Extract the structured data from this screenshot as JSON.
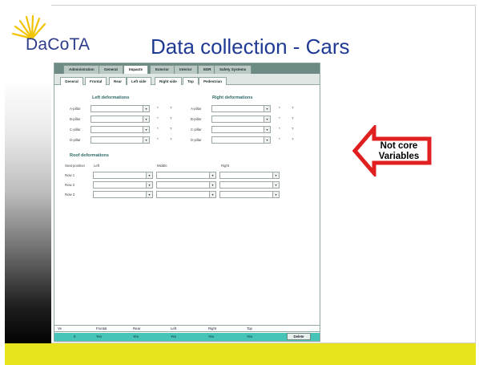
{
  "logo": {
    "text": "DaCoTA"
  },
  "slide": {
    "title": "Data collection - Cars"
  },
  "callout": {
    "line1": "Not core",
    "line2": "Variables",
    "color": "#e02020"
  },
  "main_tabs": [
    "Administration",
    "General",
    "Impacts",
    "Exterior",
    "Interior",
    "EDR",
    "Safety Systems"
  ],
  "main_tab_active": "Impacts",
  "sub_tabs": [
    "General",
    "Frontal",
    "Rear",
    "Left side",
    "Right side",
    "Top",
    "Pedestrian"
  ],
  "sub_tab_active": "Top",
  "deformations": {
    "left_title": "Left deformations",
    "right_title": "Right deformations",
    "rows": [
      "A-pillar",
      "B-pillar",
      "C-pillar",
      "D-pillar"
    ],
    "marks": [
      "*",
      "?"
    ]
  },
  "roof": {
    "title": "Roof deformations",
    "seat_position_label": "Seat position",
    "columns": [
      "Left",
      "Middle",
      "Right"
    ],
    "rows": [
      "Row 1",
      "Row 2",
      "Row 3"
    ]
  },
  "summary_table": {
    "headers": [
      "Ve",
      "Frontal",
      "Rear",
      "Left",
      "Right",
      "Top"
    ],
    "row": [
      "0",
      "Yes",
      "Yes",
      "Yes",
      "Yes",
      "Yes"
    ],
    "delete_label": "Delete"
  },
  "colors": {
    "title_blue": "#1f3a93",
    "band_yellow": "#e9e51c",
    "row_teal": "#46c4b8",
    "tab_bar": "#6e8a84"
  }
}
